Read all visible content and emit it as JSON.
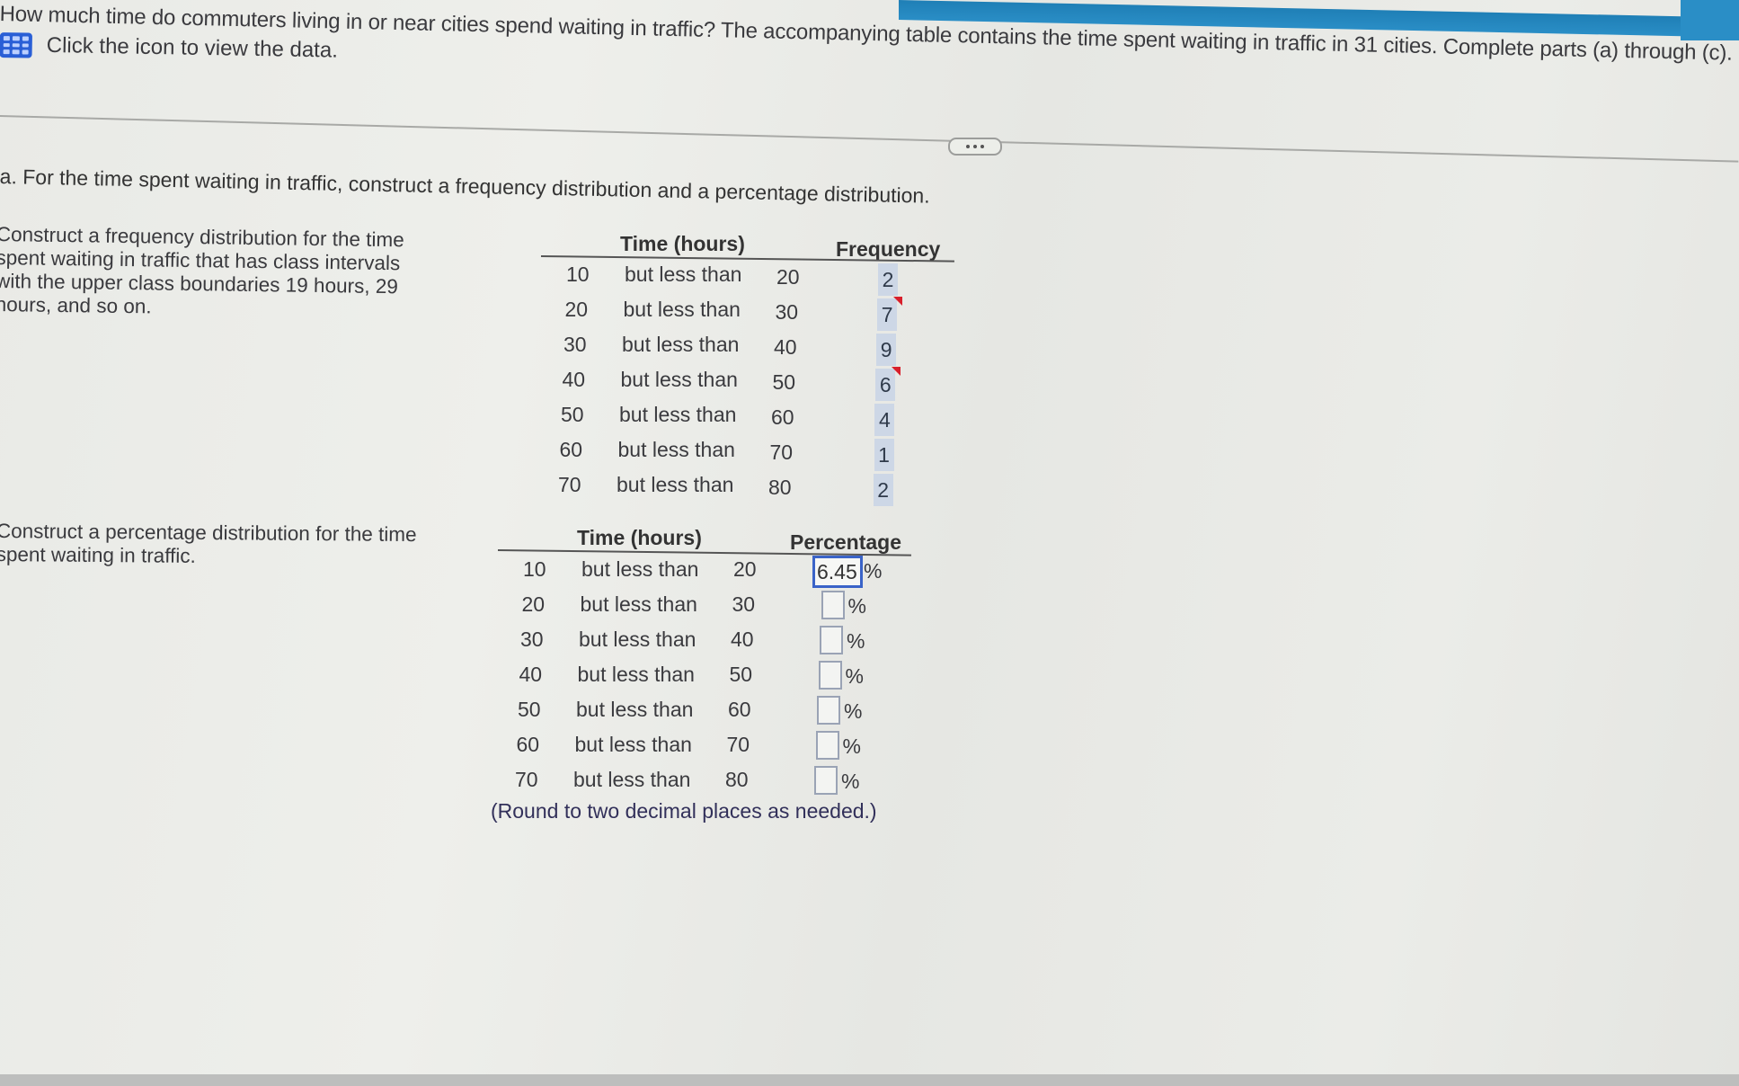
{
  "header": {
    "question": "How much time do commuters living in or near cities spend waiting in traffic? The accompanying table contains the time spent waiting in traffic in 31 cities. Complete parts (a) through (c).",
    "data_link_text": "Click the icon to view the data.",
    "data_icon": "table-grid-icon"
  },
  "more_button": {
    "icon": "ellipsis-icon"
  },
  "part_a": {
    "prompt": "a. For the time spent waiting in traffic, construct a frequency distribution and a percentage distribution.",
    "frequency": {
      "instruction_lines": [
        "Construct a frequency distribution for the time",
        "spent waiting in traffic that has class intervals",
        "with the upper class boundaries 19 hours, 29",
        "hours, and so on."
      ],
      "col_time": "Time (hours)",
      "col_value": "Frequency",
      "rows": [
        {
          "low": "10",
          "mid": "but less than",
          "high": "20",
          "value": "2",
          "flag": false
        },
        {
          "low": "20",
          "mid": "but less than",
          "high": "30",
          "value": "7",
          "flag": true
        },
        {
          "low": "30",
          "mid": "but less than",
          "high": "40",
          "value": "9",
          "flag": false
        },
        {
          "low": "40",
          "mid": "but less than",
          "high": "50",
          "value": "6",
          "flag": true
        },
        {
          "low": "50",
          "mid": "but less than",
          "high": "60",
          "value": "4",
          "flag": false
        },
        {
          "low": "60",
          "mid": "but less than",
          "high": "70",
          "value": "1",
          "flag": false
        },
        {
          "low": "70",
          "mid": "but less than",
          "high": "80",
          "value": "2",
          "flag": false
        }
      ]
    },
    "percentage": {
      "instruction_lines": [
        "Construct a percentage distribution for the time",
        "spent waiting in traffic."
      ],
      "col_time": "Time (hours)",
      "col_value": "Percentage",
      "unit": "%",
      "rows": [
        {
          "low": "10",
          "mid": "but less than",
          "high": "20",
          "value": "6.45"
        },
        {
          "low": "20",
          "mid": "but less than",
          "high": "30",
          "value": ""
        },
        {
          "low": "30",
          "mid": "but less than",
          "high": "40",
          "value": ""
        },
        {
          "low": "40",
          "mid": "but less than",
          "high": "50",
          "value": ""
        },
        {
          "low": "50",
          "mid": "but less than",
          "high": "60",
          "value": ""
        },
        {
          "low": "60",
          "mid": "but less than",
          "high": "70",
          "value": ""
        },
        {
          "low": "70",
          "mid": "but less than",
          "high": "80",
          "value": ""
        }
      ],
      "note": "(Round to two decimal places as needed.)"
    }
  },
  "colors": {
    "top_band": "#2a8ec6",
    "icon_blue": "#2a5fd6",
    "cell_highlight": "#cdd7e6",
    "error_flag": "#d81f2b",
    "active_input_border": "#3a63c8",
    "note_text": "#32305a"
  }
}
